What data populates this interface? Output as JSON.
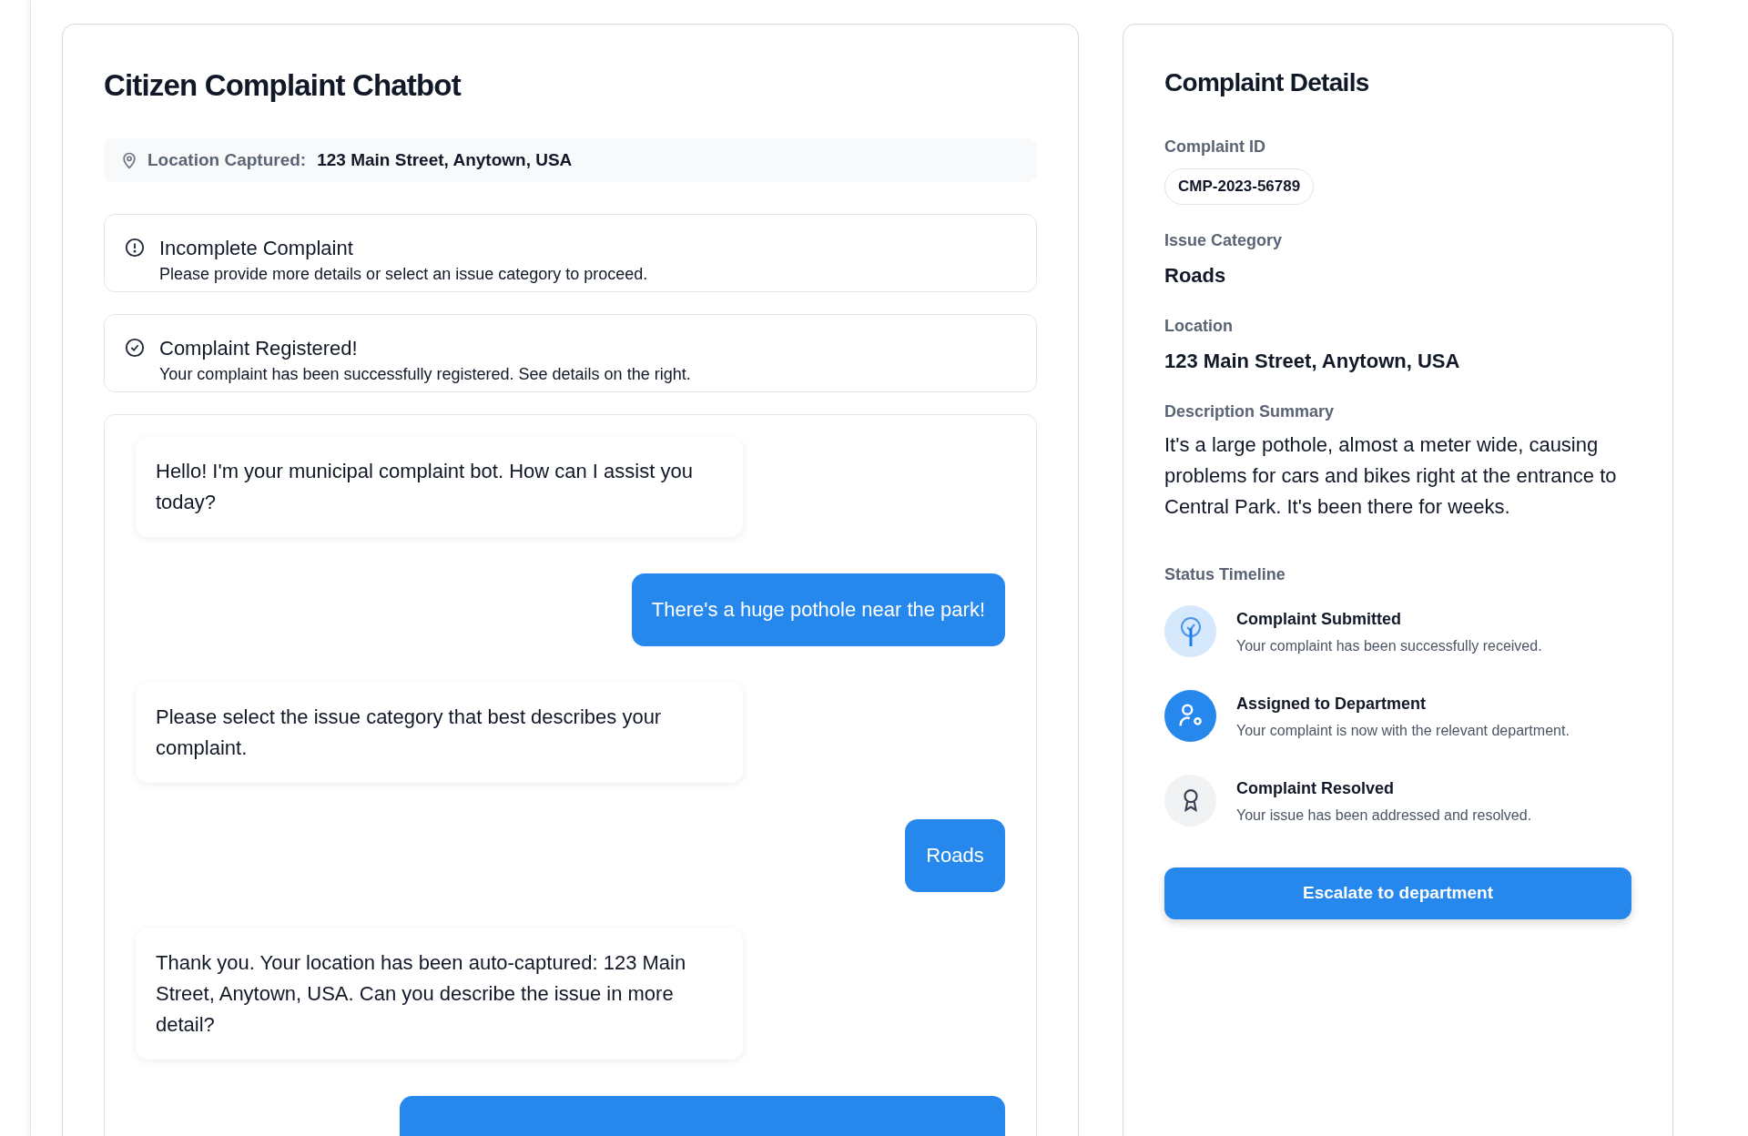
{
  "chat": {
    "title": "Citizen Complaint Chatbot",
    "location": {
      "label": "Location Captured:",
      "value": "123 Main Street, Anytown, USA"
    },
    "alerts": [
      {
        "kind": "warning",
        "title": "Incomplete Complaint",
        "text": "Please provide more details or select an issue category to proceed."
      },
      {
        "kind": "success",
        "title": "Complaint Registered!",
        "text": "Your complaint has been successfully registered. See details on the right."
      }
    ],
    "messages": [
      {
        "kind": "bot",
        "text": "Hello! I'm your municipal complaint bot. How can I assist you today?"
      },
      {
        "kind": "user",
        "text": "There's a huge pothole near the park!"
      },
      {
        "kind": "bot",
        "text": "Please select the issue category that best describes your complaint."
      },
      {
        "kind": "user",
        "text": "Roads"
      },
      {
        "kind": "bot",
        "text": "Thank you. Your location has been auto-captured: 123 Main Street, Anytown, USA. Can you describe the issue in more detail?"
      },
      {
        "kind": "user"
      }
    ]
  },
  "details": {
    "title": "Complaint Details",
    "id": {
      "label": "Complaint ID",
      "value": "CMP-2023-56789"
    },
    "category": {
      "label": "Issue Category",
      "value": "Roads"
    },
    "location": {
      "label": "Location",
      "value": "123 Main Street, Anytown, USA"
    },
    "description": {
      "label": "Description Summary",
      "value": "It's a large pothole, almost a meter wide, causing problems for cars and bikes right at the entrance to Central Park. It's been there for weeks."
    },
    "timeline": {
      "label": "Status Timeline",
      "steps": [
        {
          "kind": "done",
          "title": "Complaint Submitted",
          "text": "Your complaint has been successfully received."
        },
        {
          "kind": "active",
          "title": "Assigned to Department",
          "text": "Your complaint is now with the relevant department."
        },
        {
          "kind": "pending",
          "title": "Complaint Resolved",
          "text": "Your issue has been addressed and resolved."
        }
      ]
    },
    "button": "Escalate to department"
  }
}
